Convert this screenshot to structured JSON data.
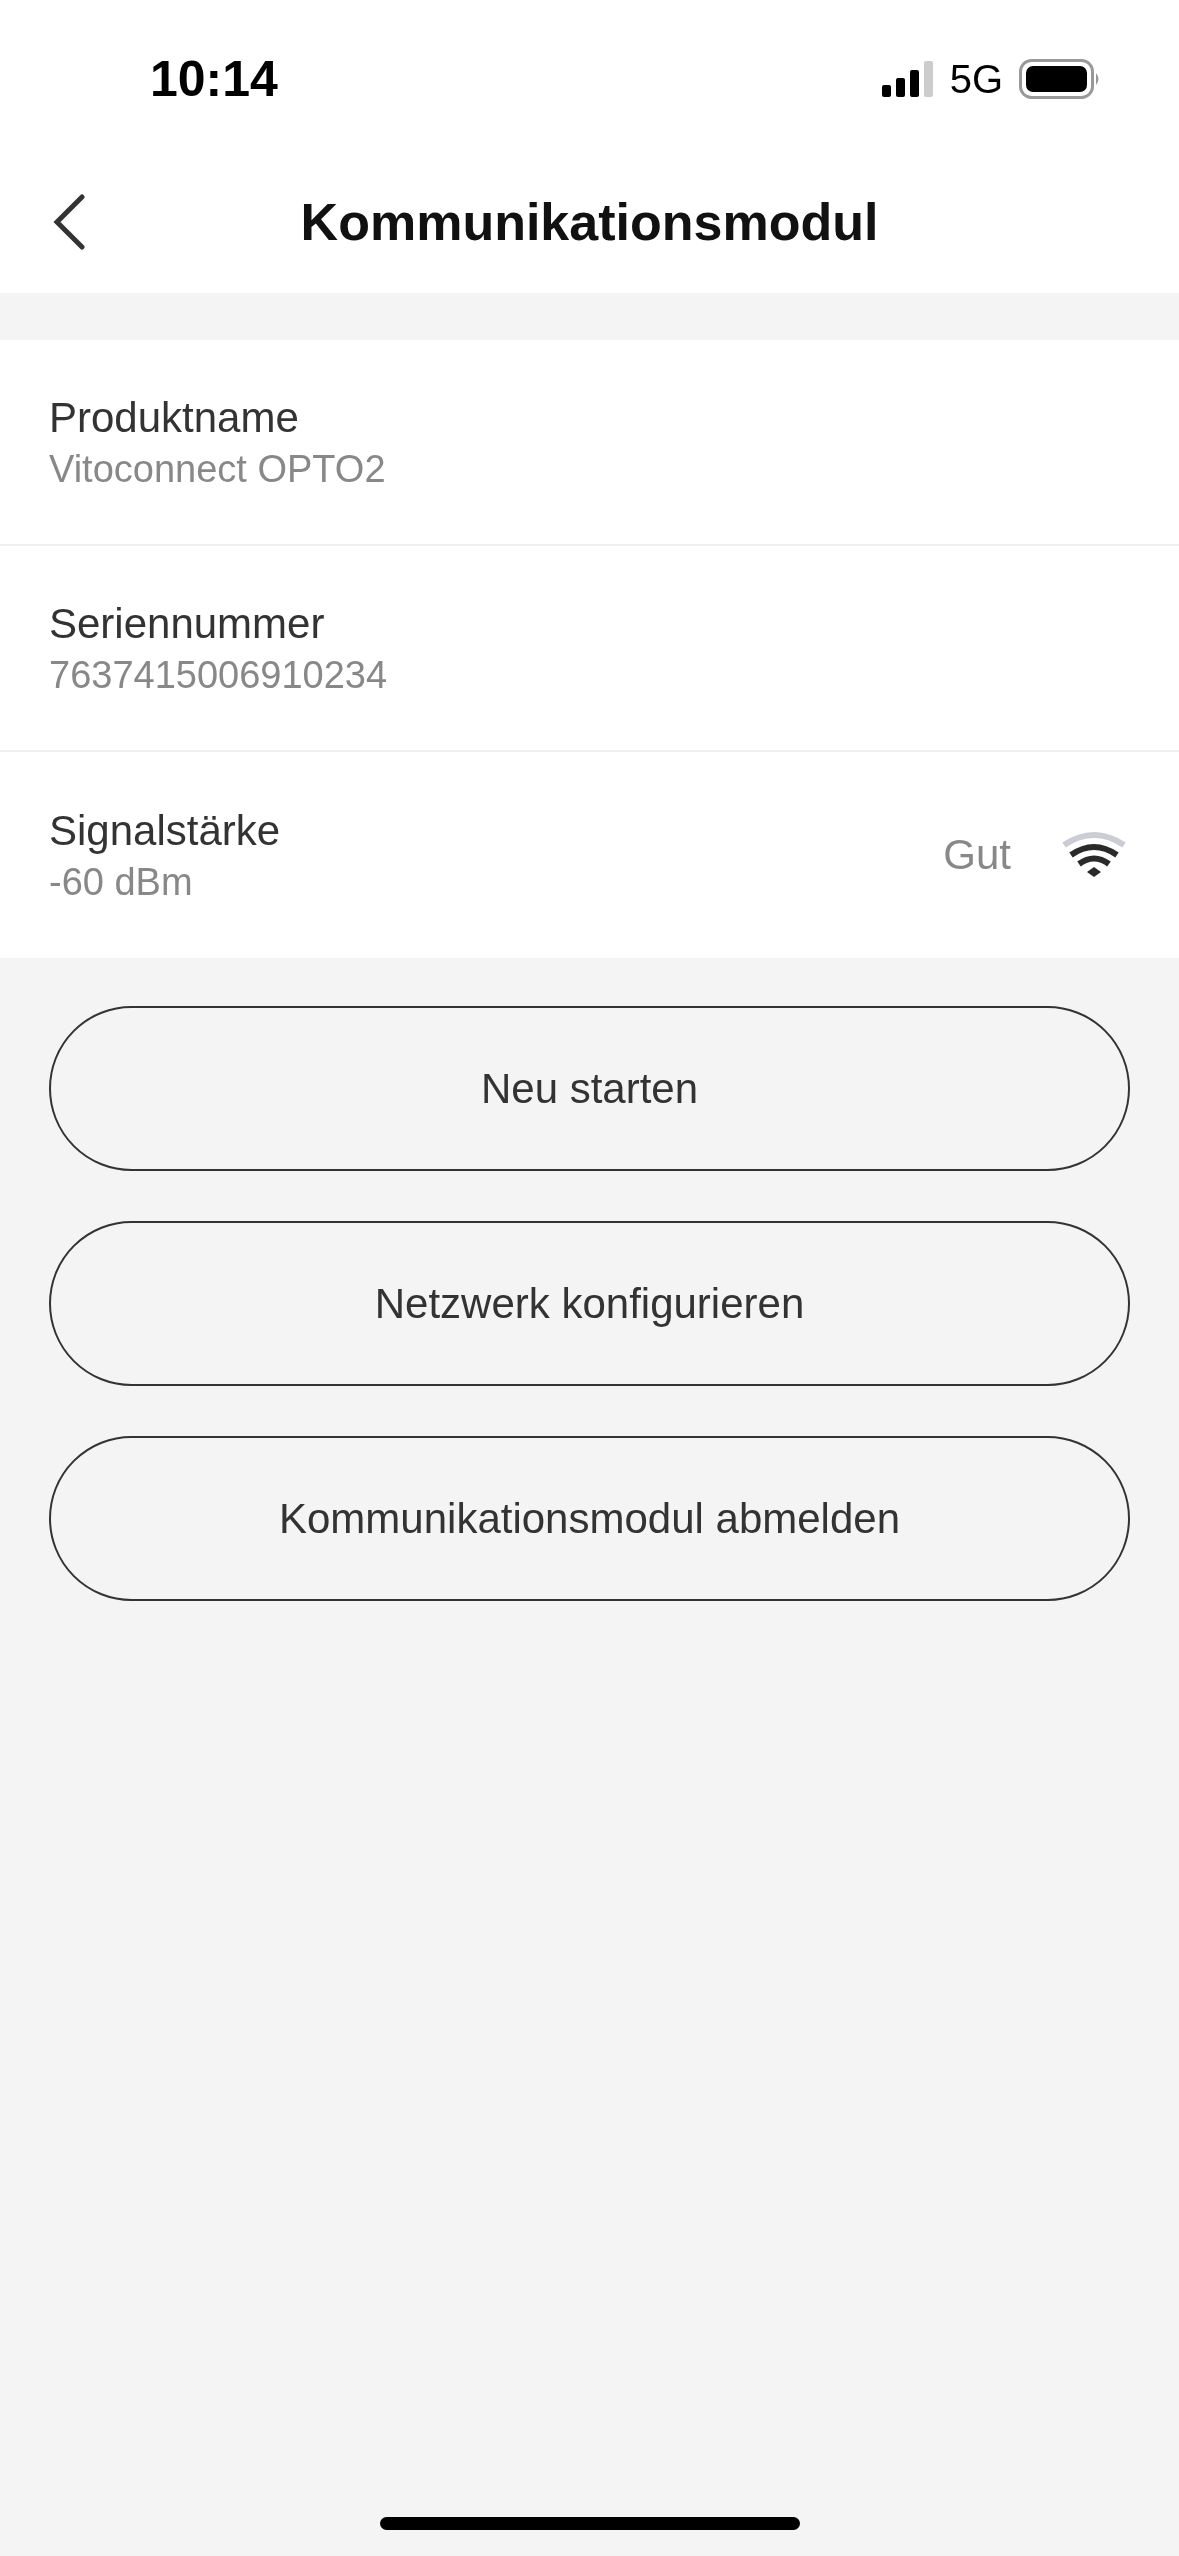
{
  "status_bar": {
    "time": "10:14",
    "network": "5G"
  },
  "nav_bar": {
    "title": "Kommunikationsmodul"
  },
  "info_rows": [
    {
      "label": "Produktname",
      "value": "Vitoconnect OPTO2"
    },
    {
      "label": "Seriennummer",
      "value": "7637415006910234"
    },
    {
      "label": "Signalstärke",
      "value": "-60 dBm",
      "rating": "Gut"
    }
  ],
  "buttons": [
    "Neu starten",
    "Netzwerk konfigurieren",
    "Kommunikationsmodul abmelden"
  ]
}
